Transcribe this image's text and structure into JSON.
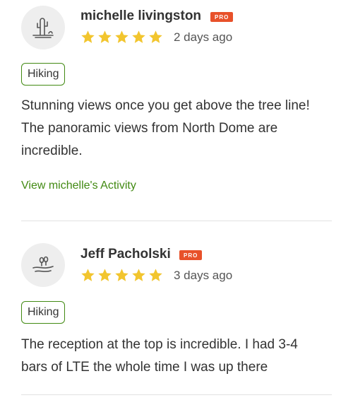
{
  "colors": {
    "accent": "#428a13",
    "pro_badge": "#e8512a",
    "star": "#f2c52e",
    "divider": "#e2e2e2"
  },
  "reviews": [
    {
      "reviewer": "michelle livingston",
      "badge": "PRO",
      "avatar_icon": "cactus-icon",
      "rating": 5,
      "date": "2 days ago",
      "activity_tag": "Hiking",
      "text_lines": [
        "Stunning views once you get above the tree line!",
        "The panoramic views from North Dome are",
        "incredible."
      ],
      "activity_link": "View michelle's Activity"
    },
    {
      "reviewer": "Jeff Pacholski",
      "badge": "PRO",
      "avatar_icon": "landscape-icon",
      "rating": 5,
      "date": "3 days ago",
      "activity_tag": "Hiking",
      "text_lines": [
        "The reception at the top is incredible. I had 3-4",
        "bars of LTE the whole time I was up there"
      ]
    }
  ]
}
